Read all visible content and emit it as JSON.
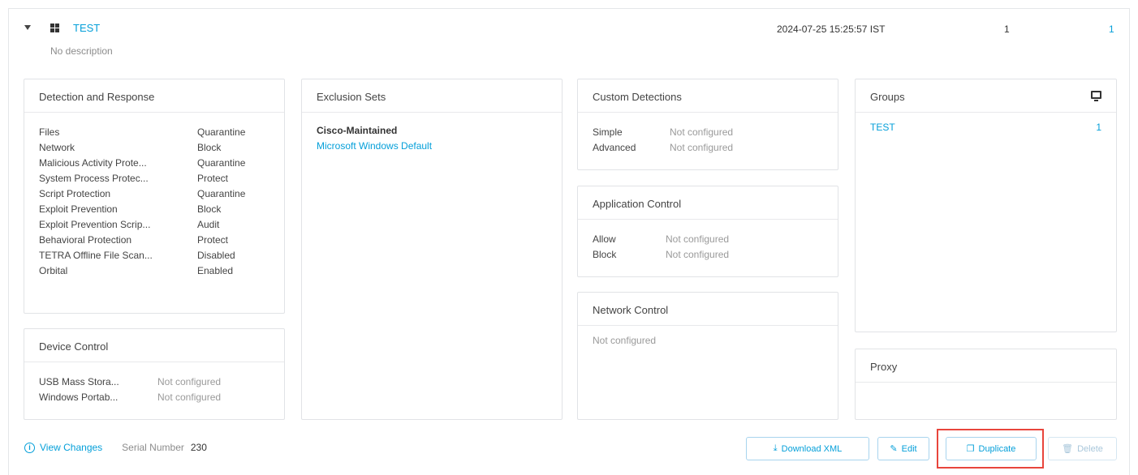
{
  "policy": {
    "name": "TEST",
    "description": "No description",
    "date": "2024-07-25 15:25:57 IST",
    "count_a": "1",
    "count_b": "1"
  },
  "detection": {
    "title": "Detection and Response",
    "rows": [
      {
        "k": "Files",
        "v": "Quarantine"
      },
      {
        "k": "Network",
        "v": "Block"
      },
      {
        "k": "Malicious Activity Prote...",
        "v": "Quarantine"
      },
      {
        "k": "System Process Protec...",
        "v": "Protect"
      },
      {
        "k": "Script Protection",
        "v": "Quarantine"
      },
      {
        "k": "Exploit Prevention",
        "v": "Block"
      },
      {
        "k": "Exploit Prevention Scrip...",
        "v": "Audit"
      },
      {
        "k": "Behavioral Protection",
        "v": "Protect"
      },
      {
        "k": "TETRA Offline File Scan...",
        "v": "Disabled"
      },
      {
        "k": "Orbital",
        "v": "Enabled"
      }
    ]
  },
  "device_control": {
    "title": "Device Control",
    "rows": [
      {
        "k": "USB Mass Stora...",
        "v": "Not configured"
      },
      {
        "k": "Windows Portab...",
        "v": "Not configured"
      }
    ]
  },
  "exclusions": {
    "title": "Exclusion Sets",
    "main": "Cisco-Maintained",
    "link": "Microsoft Windows Default"
  },
  "custom_detections": {
    "title": "Custom Detections",
    "rows": [
      {
        "k": "Simple",
        "v": "Not configured"
      },
      {
        "k": "Advanced",
        "v": "Not configured"
      }
    ]
  },
  "app_control": {
    "title": "Application Control",
    "rows": [
      {
        "k": "Allow",
        "v": "Not configured"
      },
      {
        "k": "Block",
        "v": "Not configured"
      }
    ]
  },
  "network_control": {
    "title": "Network Control",
    "text": "Not configured"
  },
  "groups": {
    "title": "Groups",
    "name": "TEST",
    "count": "1",
    "icon": "monitor-icon"
  },
  "proxy": {
    "title": "Proxy"
  },
  "footer": {
    "view_changes": "View Changes",
    "serial_label": "Serial Number",
    "serial_value": "230",
    "download": "Download XML",
    "edit": "Edit",
    "duplicate": "Duplicate",
    "delete": "Delete"
  },
  "colors": {
    "link": "#049fd9",
    "highlight": "#e8453c"
  }
}
